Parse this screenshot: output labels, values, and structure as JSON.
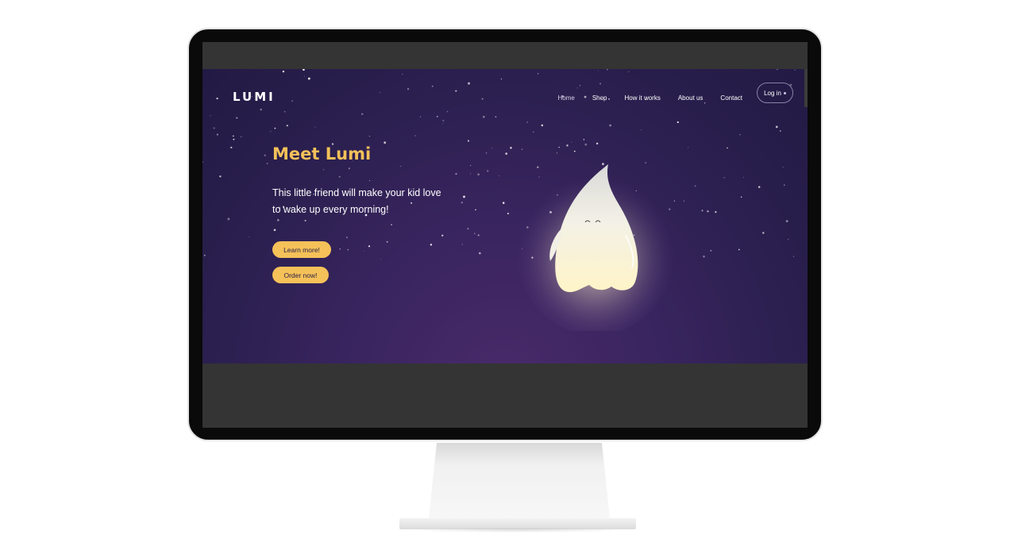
{
  "site": {
    "logo_text": "LUMI",
    "nav": {
      "items": [
        {
          "label": "Home",
          "active": true
        },
        {
          "label": "Shop",
          "active": false
        },
        {
          "label": "How it works",
          "active": false
        },
        {
          "label": "About us",
          "active": false
        },
        {
          "label": "Contact",
          "active": false
        }
      ],
      "login_label": "Log in"
    },
    "hero": {
      "title": "Meet Lumi",
      "subtitle": "This little friend will make your kid love to wake up every morning!",
      "learn_more_label": "Learn more!",
      "order_now_label": "Order now!"
    }
  },
  "colors": {
    "accent": "#f5c159",
    "hero_bg": "#2a1f4e",
    "screen_bg": "#343434"
  },
  "icons": [
    "lumi-character-illustration",
    "login-dot-icon"
  ]
}
